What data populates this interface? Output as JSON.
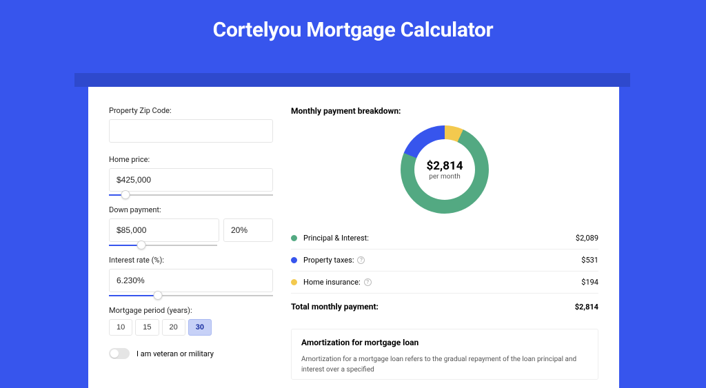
{
  "title": "Cortelyou Mortgage Calculator",
  "form": {
    "zip_label": "Property Zip Code:",
    "zip_value": "",
    "home_price_label": "Home price:",
    "home_price_value": "$425,000",
    "home_price_slider_pct": 10,
    "down_payment_label": "Down payment:",
    "down_payment_value": "$85,000",
    "down_payment_pct_value": "20%",
    "down_payment_slider_pct": 20,
    "interest_label": "Interest rate (%):",
    "interest_value": "6.230%",
    "interest_slider_pct": 30,
    "period_label": "Mortgage period (years):",
    "periods": [
      "10",
      "15",
      "20",
      "30"
    ],
    "period_selected": 3,
    "veteran_label": "I am veteran or military"
  },
  "breakdown": {
    "title": "Monthly payment breakdown:",
    "center_value": "$2,814",
    "center_sub": "per month",
    "rows": [
      {
        "color": "green",
        "label": "Principal & Interest:",
        "help": false,
        "value": "$2,089"
      },
      {
        "color": "blue",
        "label": "Property taxes:",
        "help": true,
        "value": "$531"
      },
      {
        "color": "yellow",
        "label": "Home insurance:",
        "help": true,
        "value": "$194"
      }
    ],
    "total_label": "Total monthly payment:",
    "total_value": "$2,814"
  },
  "amort": {
    "title": "Amortization for mortgage loan",
    "text": "Amortization for a mortgage loan refers to the gradual repayment of the loan principal and interest over a specified"
  },
  "chart_data": {
    "type": "pie",
    "title": "Monthly payment breakdown",
    "series": [
      {
        "name": "Principal & Interest",
        "value": 2089,
        "color": "#53a982"
      },
      {
        "name": "Property taxes",
        "value": 531,
        "color": "#3755ed"
      },
      {
        "name": "Home insurance",
        "value": 194,
        "color": "#f3c94e"
      }
    ],
    "total": 2814,
    "unit": "USD per month"
  }
}
